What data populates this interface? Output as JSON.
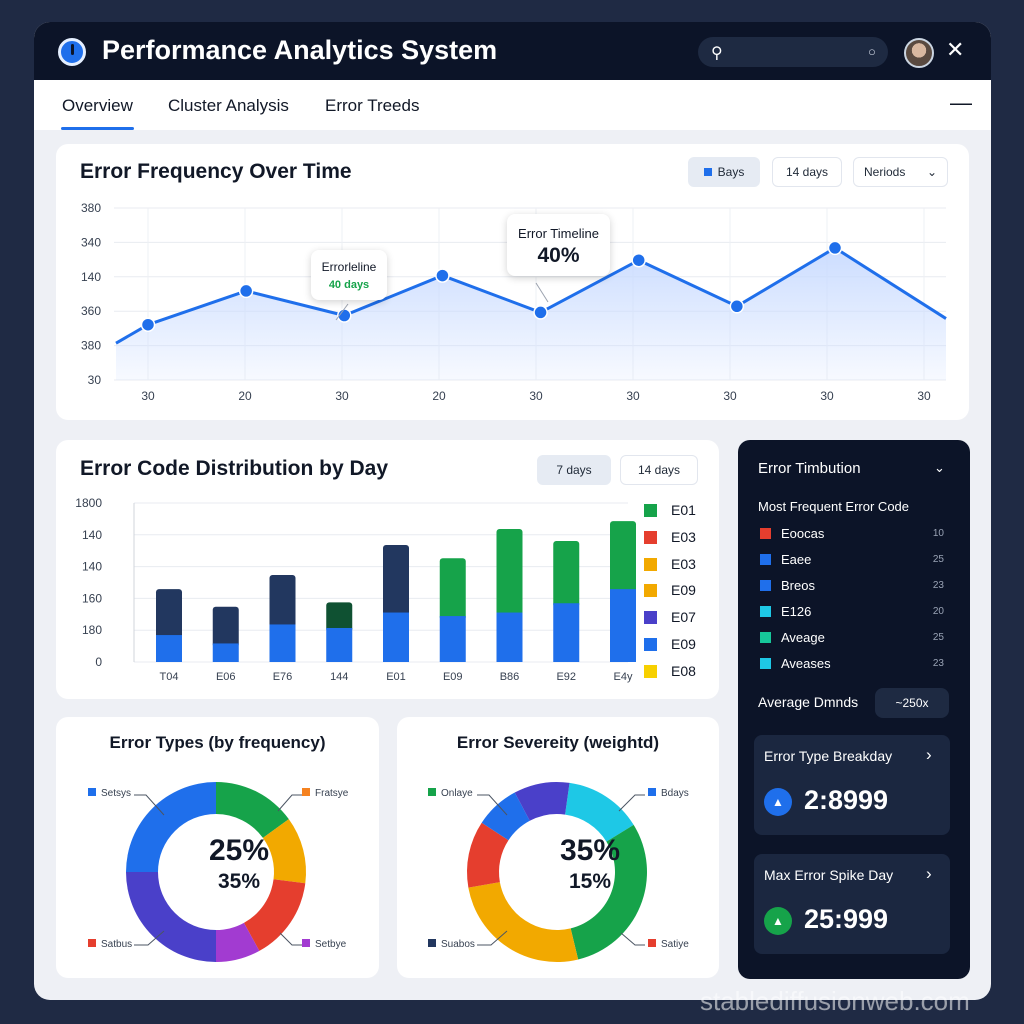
{
  "app": {
    "title": "Performance Analytics System",
    "search": {
      "placeholder": ""
    }
  },
  "tabs": [
    {
      "label": "Overview",
      "active": true
    },
    {
      "label": "Cluster Analysis",
      "active": false
    },
    {
      "label": "Error Treeds",
      "active": false
    }
  ],
  "line_card": {
    "title": "Error Frequency Over Time",
    "filters": [
      "Bays",
      "14 days",
      "Neriods"
    ],
    "tooltip_small": {
      "title": "Errorleline",
      "value": "40 days"
    },
    "tooltip_large": {
      "title": "Error Timeline",
      "value": "40%"
    }
  },
  "bar_card": {
    "title": "Error Code Distribution by Day",
    "filters": [
      "7 days",
      "14 days"
    ]
  },
  "donut_left": {
    "title": "Error Types (by frequency)",
    "center_big": "25%",
    "center_small": "35%",
    "labels": [
      "Setsys",
      "Fratsye",
      "Satbus",
      "Setbye"
    ],
    "slices": [
      {
        "value": 15,
        "color": "#16a34a"
      },
      {
        "value": 12,
        "color": "#f2a900"
      },
      {
        "value": 15,
        "color": "#e53e2e"
      },
      {
        "value": 8,
        "color": "#a23bd1"
      },
      {
        "value": 25,
        "color": "#4a40c9"
      },
      {
        "value": 25,
        "color": "#1f6feb"
      }
    ]
  },
  "donut_right": {
    "title": "Error Severeity (weightd)",
    "center_big": "35%",
    "center_small": "15%",
    "labels": [
      "Onlaye",
      "Bdays",
      "Suabos",
      "Satiye"
    ],
    "slices": [
      {
        "value": 14,
        "color": "#1ec8e6"
      },
      {
        "value": 30,
        "color": "#16a34a"
      },
      {
        "value": 26,
        "color": "#f2a900"
      },
      {
        "value": 12,
        "color": "#e53e2e"
      },
      {
        "value": 8,
        "color": "#1f6feb"
      },
      {
        "value": 10,
        "color": "#4a40c9"
      }
    ]
  },
  "dark_panel": {
    "title": "Error Timbution",
    "subtitle": "Most Frequent Error Code",
    "items": [
      {
        "label": "Eoocas",
        "count": "10",
        "color": "#e53e2e"
      },
      {
        "label": "Eaee",
        "count": "25",
        "color": "#1f6feb"
      },
      {
        "label": "Breos",
        "count": "23",
        "color": "#1f6feb"
      },
      {
        "label": "E126",
        "count": "20",
        "color": "#1ec8e6"
      },
      {
        "label": "Aveage",
        "count": "25",
        "color": "#16c79a"
      },
      {
        "label": "Aveases",
        "count": "23",
        "color": "#1ec8e6"
      }
    ],
    "average_label": "Average Dmnds",
    "average_value": "~250x",
    "breakdown": {
      "title": "Error Type Breakday",
      "value": "2:8999"
    },
    "spike": {
      "title": "Max Error Spike Day",
      "value": "25:999"
    }
  },
  "chart_data": [
    {
      "type": "area",
      "title": "Error Frequency Over Time",
      "y_tick_labels": [
        "380",
        "340",
        "140",
        "360",
        "380",
        "30"
      ],
      "x_tick_labels": [
        "30",
        "20",
        "30",
        "20",
        "30",
        "30",
        "30",
        "30",
        "30"
      ],
      "series": [
        {
          "values": [
            90,
            145,
            105,
            170,
            110,
            195,
            120,
            215
          ]
        }
      ],
      "line_endpoints": [
        60,
        100
      ],
      "ylim": [
        0,
        280
      ],
      "grid": true,
      "colors": {
        "line": "#1f6feb",
        "fill": "#c9dbff"
      }
    },
    {
      "type": "bar",
      "title": "Error Code Distribution by Day",
      "stacked": true,
      "categories": [
        "T04",
        "E06",
        "E76",
        "144",
        "E01",
        "E09",
        "B86",
        "E92",
        "E4y"
      ],
      "y_tick_labels": [
        "1800",
        "140",
        "140",
        "160",
        "180",
        "0"
      ],
      "ylim": [
        0,
        1800
      ],
      "series": [
        {
          "name": "lower",
          "values": [
            305,
            210,
            425,
            385,
            560,
            520,
            560,
            665,
            825
          ],
          "colors": [
            "#1f6feb",
            "#1f6feb",
            "#1f6feb",
            "#1f6feb",
            "#1f6feb",
            "#1f6feb",
            "#1f6feb",
            "#1f6feb",
            "#1f6feb"
          ]
        },
        {
          "name": "upper",
          "values": [
            520,
            415,
            560,
            290,
            765,
            655,
            945,
            705,
            770
          ],
          "colors": [
            "#22375f",
            "#22375f",
            "#22375f",
            "#0f5132",
            "#22375f",
            "#16a34a",
            "#16a34a",
            "#16a34a",
            "#16a34a"
          ]
        }
      ],
      "legend": [
        {
          "label": "E01",
          "color": "#16a34a"
        },
        {
          "label": "E03",
          "color": "#e53e2e"
        },
        {
          "label": "E03",
          "color": "#f2a900"
        },
        {
          "label": "E09",
          "color": "#f2a900"
        },
        {
          "label": "E07",
          "color": "#4a40c9"
        },
        {
          "label": "E09",
          "color": "#1f6feb"
        },
        {
          "label": "E08",
          "color": "#f7d000"
        }
      ],
      "legend_position": "right",
      "grid": true
    }
  ],
  "watermark": "stablediffusionweb.com"
}
